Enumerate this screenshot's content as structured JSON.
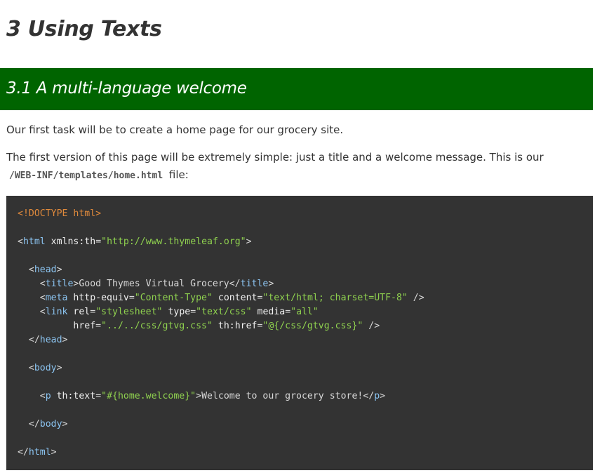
{
  "heading": "3 Using Texts",
  "section": {
    "title": "3.1 A multi-language welcome"
  },
  "paragraphs": {
    "p1": "Our first task will be to create a home page for our grocery site.",
    "p2_before": "The first version of this page will be extremely simple: just a title and a welcome message. This is our ",
    "p2_code": "/WEB-INF/templates/home.html",
    "p2_after": " file:"
  },
  "code": {
    "doctype": "<!DOCTYPE html>",
    "html_open_lt": "<",
    "html_tag": "html",
    "xmlns_attr": "xmlns:th",
    "xmlns_val": "\"http://www.thymeleaf.org\"",
    "head_tag": "head",
    "title_tag": "title",
    "title_text": "Good Thymes Virtual Grocery",
    "meta_tag": "meta",
    "meta_attr1": "http-equiv",
    "meta_val1": "\"Content-Type\"",
    "meta_attr2": "content",
    "meta_val2": "\"text/html; charset=UTF-8\"",
    "link_tag": "link",
    "link_attr1": "rel",
    "link_val1": "\"stylesheet\"",
    "link_attr2": "type",
    "link_val2": "\"text/css\"",
    "link_attr3": "media",
    "link_val3": "\"all\"",
    "link_attr4": "href",
    "link_val4": "\"../../css/gtvg.css\"",
    "link_attr5": "th:href",
    "link_val5": "\"@{/css/gtvg.css}\"",
    "body_tag": "body",
    "p_tag": "p",
    "p_attr": "th:text",
    "p_val": "\"#{home.welcome}\"",
    "p_text": "Welcome to our grocery store!"
  },
  "colors": {
    "section_bar": "#006400",
    "code_bg": "#333333",
    "code_tag": "#8cc5f2",
    "code_value": "#8fd14f",
    "code_doctype": "#e08a3c"
  }
}
